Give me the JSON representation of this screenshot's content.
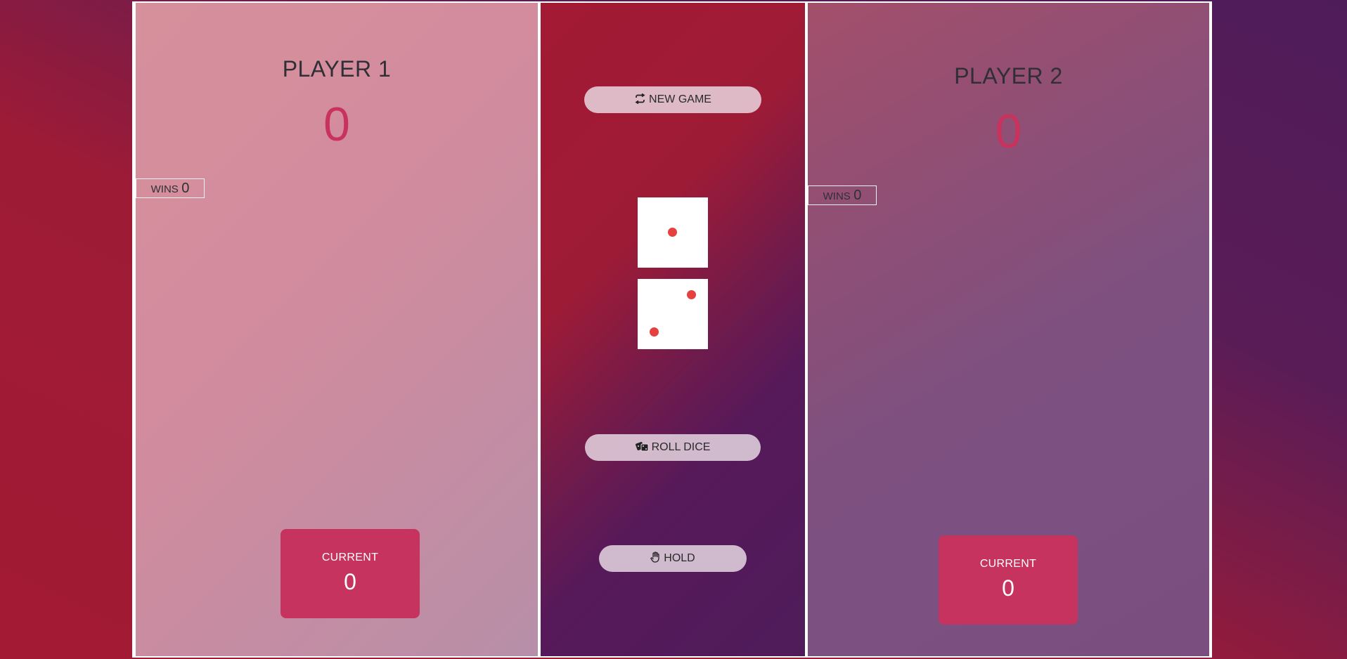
{
  "player1": {
    "name": "PLAYER 1",
    "score": "0",
    "wins_label": "WINS",
    "wins_value": "0",
    "current_label": "CURRENT",
    "current_value": "0"
  },
  "player2": {
    "name": "PLAYER 2",
    "score": "0",
    "wins_label": "WINS",
    "wins_value": "0",
    "current_label": "CURRENT",
    "current_value": "0"
  },
  "controls": {
    "new_game_label": "NEW GAME",
    "roll_dice_label": "ROLL DICE",
    "hold_label": "HOLD"
  },
  "dice": [
    {
      "value": 1
    },
    {
      "value": 2
    }
  ],
  "colors": {
    "accent": "#c6335e",
    "pip": "#e5423f",
    "background_start": "#a21a34",
    "background_end": "#4f1c5a"
  },
  "icons": {
    "new_game": "refresh-icon",
    "roll_dice": "dice-icon",
    "hold": "hand-icon"
  }
}
